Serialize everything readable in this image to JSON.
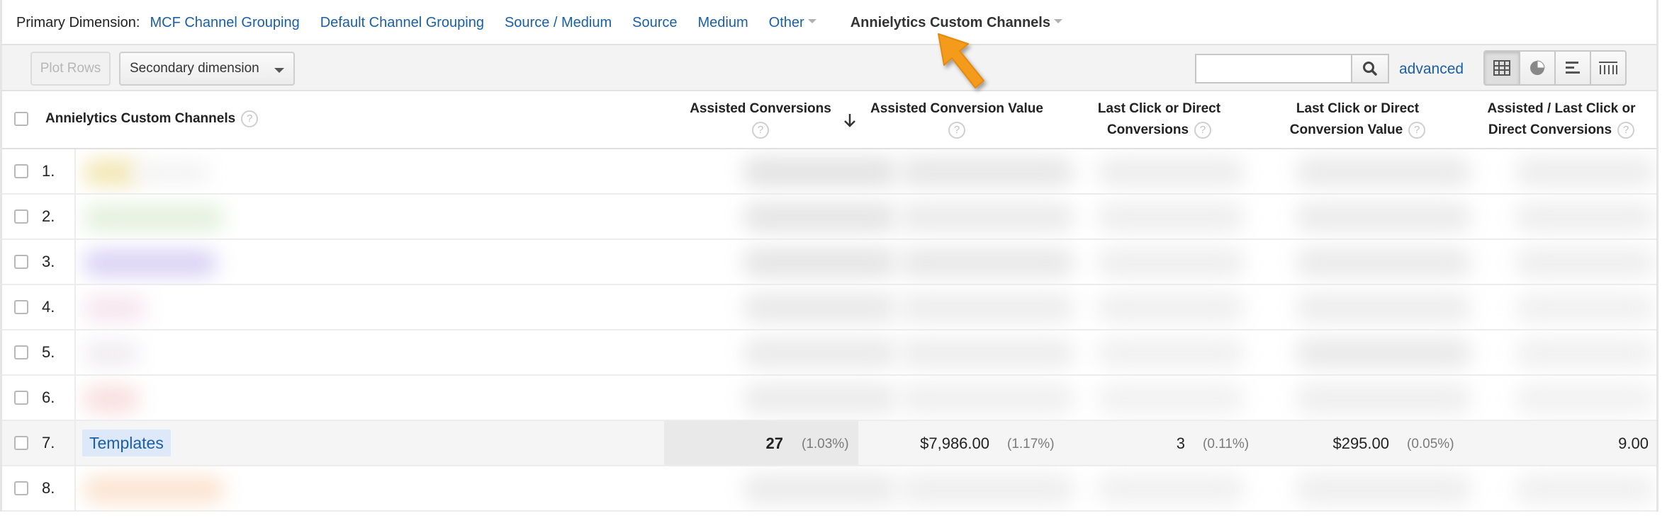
{
  "primary_dimension": {
    "label": "Primary Dimension:",
    "links": [
      "MCF Channel Grouping",
      "Default Channel Grouping",
      "Source / Medium",
      "Source",
      "Medium"
    ],
    "other_label": "Other",
    "active_label": "Annielytics Custom Channels"
  },
  "toolbar": {
    "plot_rows_label": "Plot Rows",
    "secondary_dimension_label": "Secondary dimension",
    "search_value": "",
    "advanced_label": "advanced",
    "views": [
      "table-view-icon",
      "pie-view-icon",
      "bar-view-icon",
      "pivot-view-icon"
    ]
  },
  "table": {
    "headers": {
      "dimension": "Annielytics Custom Channels",
      "assisted_conversions": "Assisted Conversions",
      "assisted_conversion_value": "Assisted Conversion Value",
      "last_click_conversions_line1": "Last Click or Direct",
      "last_click_conversions_line2": "Conversions",
      "last_click_value_line1": "Last Click or Direct",
      "last_click_value_line2": "Conversion Value",
      "ratio_line1": "Assisted / Last Click or",
      "ratio_line2": "Direct Conversions",
      "help_glyph": "?"
    },
    "rows": [
      {
        "num": "1."
      },
      {
        "num": "2."
      },
      {
        "num": "3."
      },
      {
        "num": "4."
      },
      {
        "num": "5."
      },
      {
        "num": "6."
      },
      {
        "num": "7.",
        "channel": "Templates",
        "assisted_conversions": "27",
        "assisted_conversions_pct": "(1.03%)",
        "assisted_conversion_value": "$7,986.00",
        "assisted_conversion_value_pct": "(1.17%)",
        "last_click_conversions": "3",
        "last_click_conversions_pct": "(0.11%)",
        "last_click_value": "$295.00",
        "last_click_value_pct": "(0.05%)",
        "ratio": "9.00"
      },
      {
        "num": "8."
      }
    ]
  },
  "colors": {
    "link": "#1a5fa8",
    "pointer": "#f59b1f",
    "highlight_row": "#f5f5f5",
    "sorted_column": "#e9e9e9"
  }
}
